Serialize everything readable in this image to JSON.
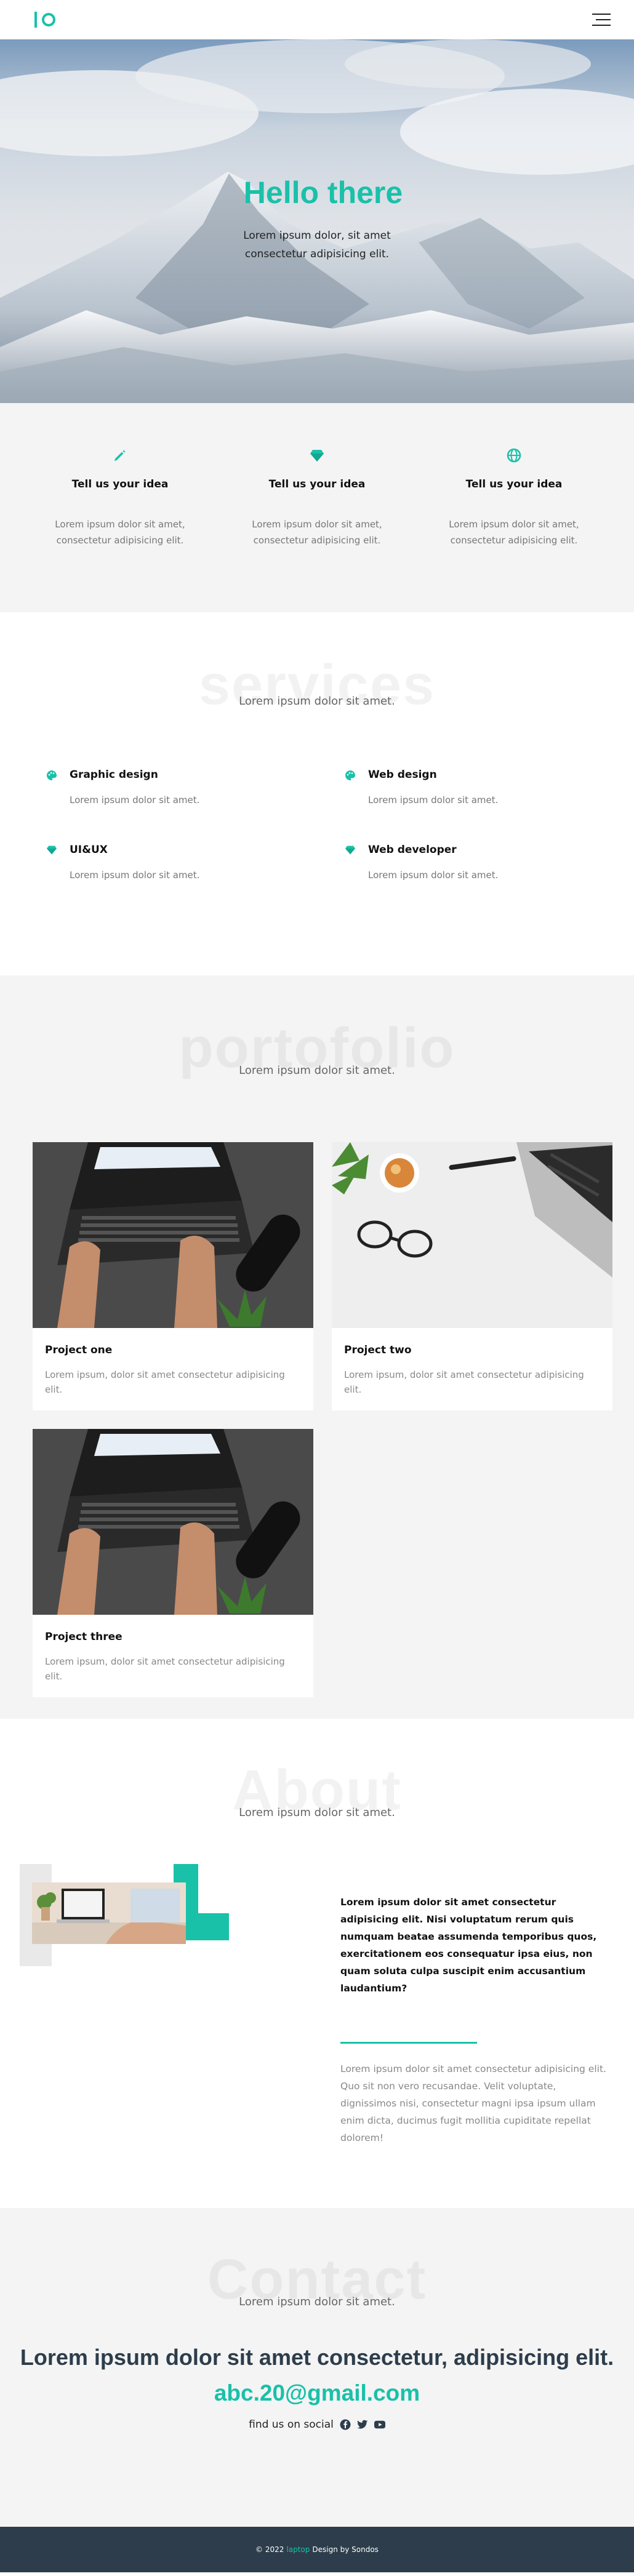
{
  "header": {
    "logo": "IO",
    "menu_icon": "hamburger-menu-icon"
  },
  "hero": {
    "title": "Hello there",
    "subtitle": "Lorem ipsum dolor, sit amet consectetur adipisicing elit."
  },
  "features": [
    {
      "icon": "pencil-icon",
      "title": "Tell us your idea",
      "text": "Lorem ipsum dolor sit amet, consectetur adipisicing elit."
    },
    {
      "icon": "gem-icon",
      "title": "Tell us your idea",
      "text": "Lorem ipsum dolor sit amet, consectetur adipisicing elit."
    },
    {
      "icon": "globe-icon",
      "title": "Tell us your idea",
      "text": "Lorem ipsum dolor sit amet, consectetur adipisicing elit."
    }
  ],
  "services": {
    "ghost": "services",
    "subtitle": "Lorem ipsum dolor sit amet.",
    "items": [
      {
        "icon": "palette-icon",
        "title": "Graphic design",
        "text": "Lorem ipsum dolor sit amet."
      },
      {
        "icon": "palette-icon",
        "title": "Web design",
        "text": "Lorem ipsum dolor sit amet."
      },
      {
        "icon": "gem-icon",
        "title": "UI&UX",
        "text": "Lorem ipsum dolor sit amet."
      },
      {
        "icon": "gem-icon",
        "title": "Web developer",
        "text": "Lorem ipsum dolor sit amet."
      }
    ]
  },
  "portfolio": {
    "ghost": "portofolio",
    "subtitle": "Lorem ipsum dolor sit amet.",
    "projects": [
      {
        "title": "Project one",
        "text": "Lorem ipsum, dolor sit amet consectetur adipisicing elit."
      },
      {
        "title": "Project two",
        "text": "Lorem ipsum, dolor sit amet consectetur adipisicing elit."
      },
      {
        "title": "Project three",
        "text": "Lorem ipsum, dolor sit amet consectetur adipisicing elit."
      }
    ]
  },
  "about": {
    "ghost": "About",
    "subtitle": "Lorem ipsum dolor sit amet.",
    "bold_text": "Lorem ipsum dolor sit amet consectetur adipisicing elit. Nisi voluptatum rerum quis numquam beatae assumenda temporibus quos, exercitationem eos consequatur ipsa eius, non quam soluta culpa suscipit enim accusantium laudantium?",
    "light_text": "Lorem ipsum dolor sit amet consectetur adipisicing elit. Quo sit non vero recusandae. Velit voluptate, dignissimos nisi, consectetur magni ipsa ipsum ullam enim dicta, ducimus fugit mollitia cupiditate repellat dolorem!"
  },
  "contact": {
    "ghost": "Contact",
    "subtitle": "Lorem ipsum dolor sit amet.",
    "title": "Lorem ipsum dolor sit amet consectetur, adipisicing elit.",
    "email": "abc.20@gmail.com",
    "social_label": "find us on social",
    "social_icons": [
      "facebook-icon",
      "twitter-icon",
      "youtube-icon"
    ]
  },
  "footer": {
    "prefix": "© 2022",
    "brand": "laptop",
    "suffix": "Design by Sondos"
  },
  "colors": {
    "accent": "#19c1a9",
    "dark": "#2d3d4b",
    "light_bg": "#f4f4f4"
  }
}
